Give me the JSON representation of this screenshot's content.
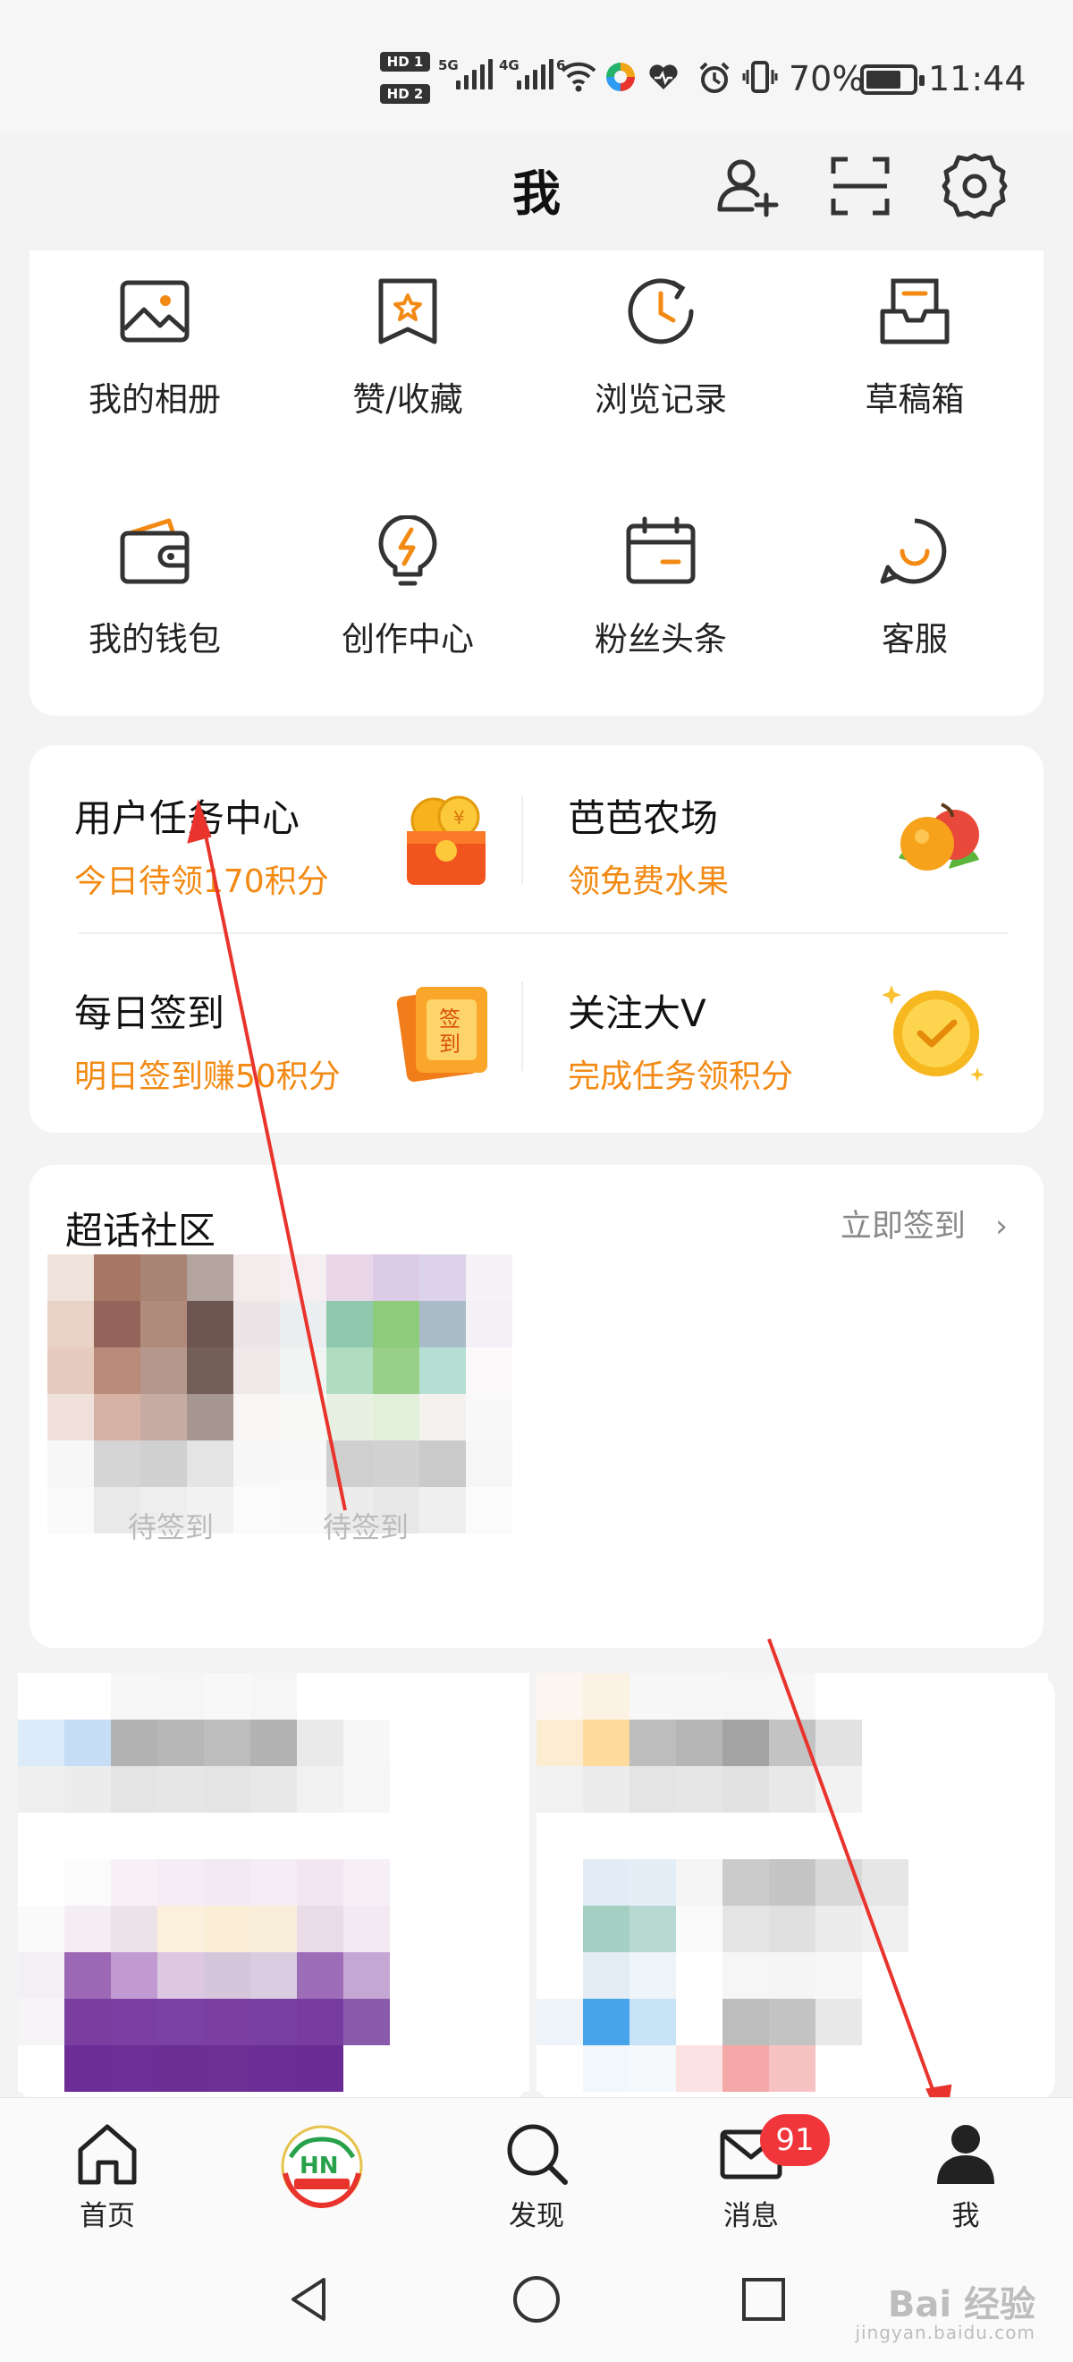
{
  "status_bar": {
    "sim1": "HD 1",
    "sim2": "HD 2",
    "net1": "5G",
    "net2": "4G",
    "wifi_tag": "6",
    "battery": "70%",
    "time": "11:44"
  },
  "header": {
    "title": "我",
    "icons": [
      "add-user-icon",
      "scan-icon",
      "settings-icon"
    ]
  },
  "quick_grid": [
    {
      "label": "我的相册",
      "icon": "photo-album-icon"
    },
    {
      "label": "赞/收藏",
      "icon": "favorite-icon"
    },
    {
      "label": "浏览记录",
      "icon": "history-icon"
    },
    {
      "label": "草稿箱",
      "icon": "drafts-icon"
    },
    {
      "label": "我的钱包",
      "icon": "wallet-icon"
    },
    {
      "label": "创作中心",
      "icon": "creator-bulb-icon"
    },
    {
      "label": "粉丝头条",
      "icon": "calendar-icon"
    },
    {
      "label": "客服",
      "icon": "customer-service-icon"
    }
  ],
  "tasks": [
    {
      "title": "用户任务中心",
      "subtitle": "今日待领170积分",
      "icon": "red-envelope-coins-icon"
    },
    {
      "title": "芭芭农场",
      "subtitle": "领免费水果",
      "icon": "fruit-icon"
    },
    {
      "title": "每日签到",
      "subtitle": "明日签到赚50积分",
      "icon": "sign-in-card-icon"
    },
    {
      "title": "关注大V",
      "subtitle": "完成任务领积分",
      "icon": "gold-check-badge-icon"
    }
  ],
  "community": {
    "title": "超话社区",
    "action": "立即签到",
    "items": [
      {
        "label": "待签到"
      },
      {
        "label": "待签到"
      }
    ]
  },
  "bottom_nav": [
    {
      "label": "首页",
      "icon": "home-icon"
    },
    {
      "label": "",
      "icon": "app-logo-icon"
    },
    {
      "label": "发现",
      "icon": "search-icon"
    },
    {
      "label": "消息",
      "icon": "mail-icon",
      "badge": "91"
    },
    {
      "label": "我",
      "icon": "profile-icon"
    }
  ],
  "watermark": {
    "brand": "Bai 经验",
    "url": "jingyan.baidu.com"
  },
  "colors": {
    "accent_orange": "#f28a14",
    "annotation_red": "#e8342c",
    "badge_red": "#f0353b"
  }
}
